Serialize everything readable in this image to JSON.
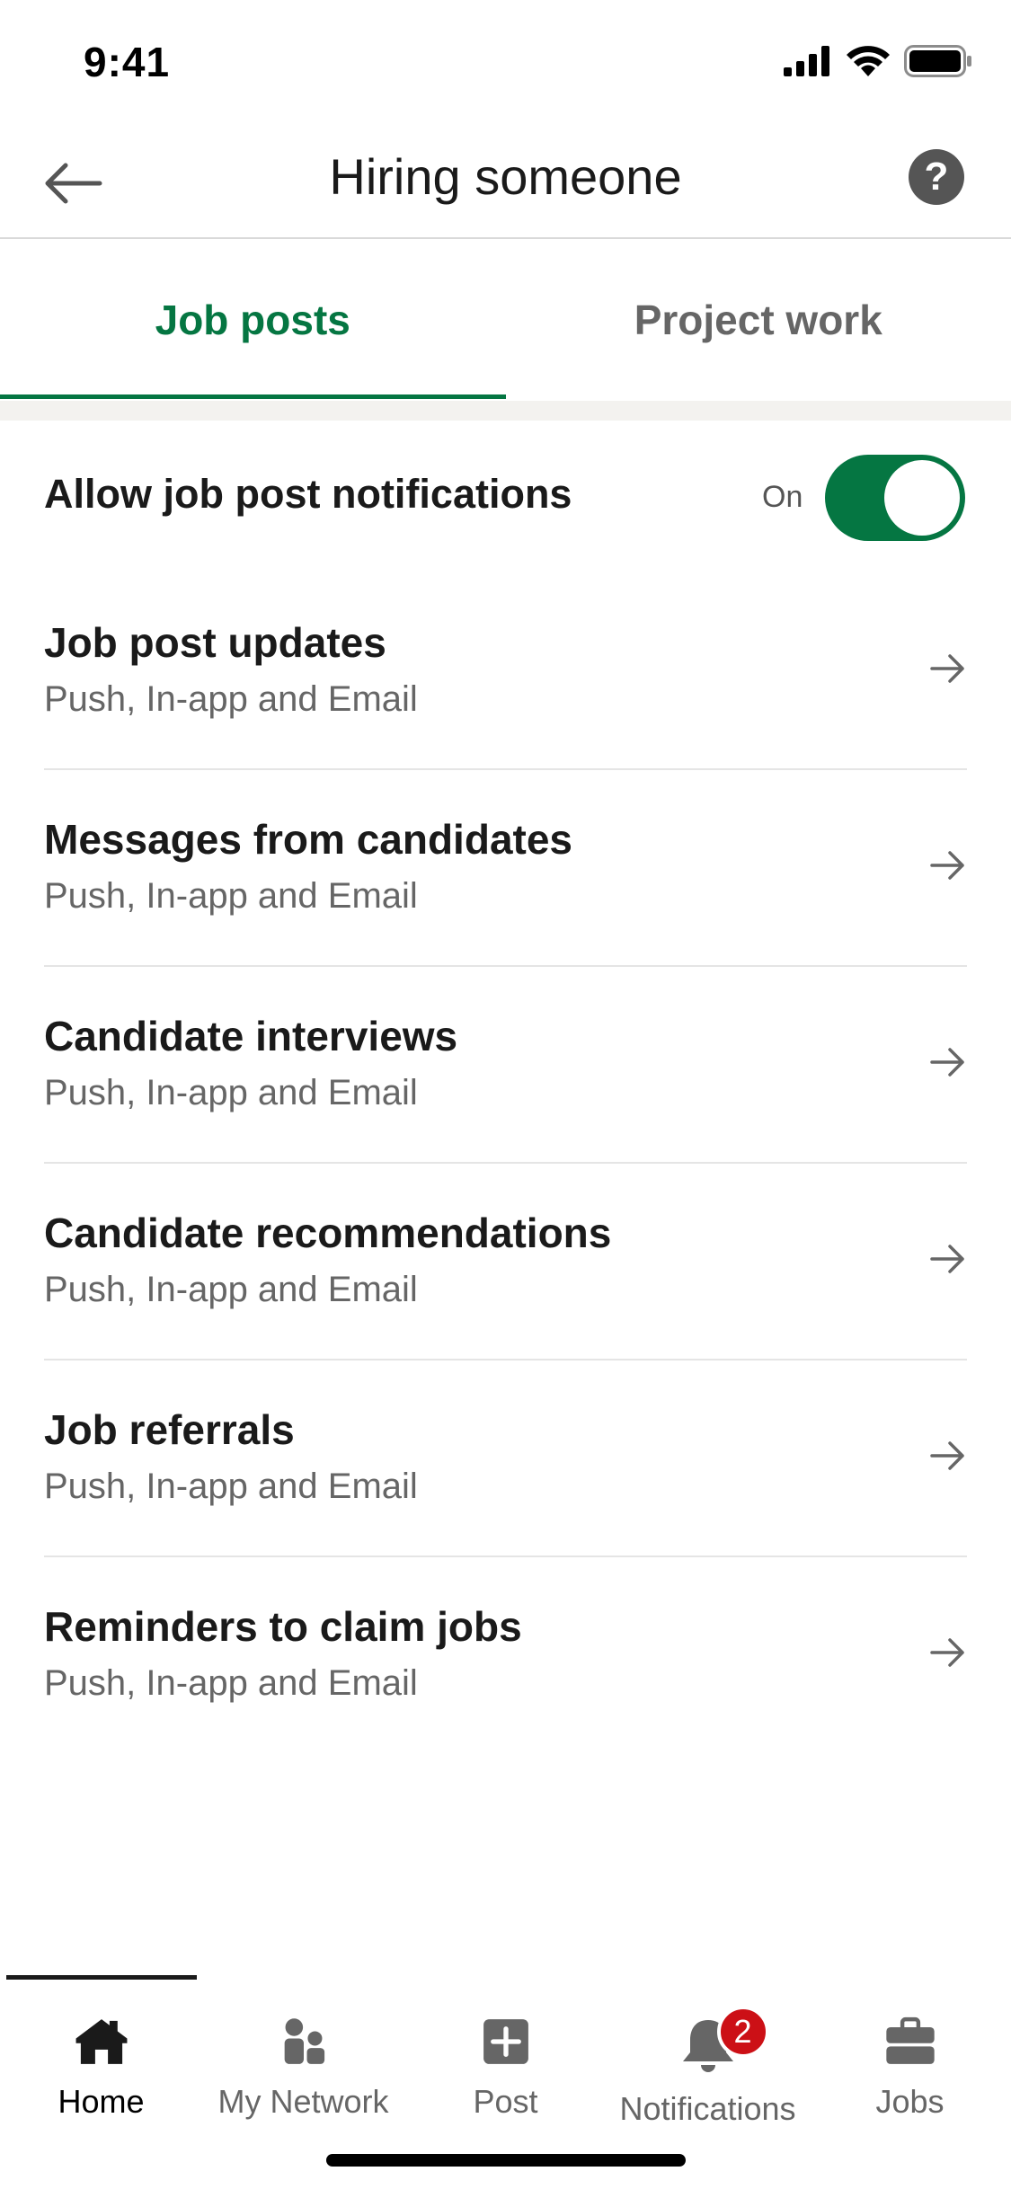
{
  "status_bar": {
    "time": "9:41",
    "icons": [
      "cellular-signal-icon",
      "wifi-icon",
      "battery-icon"
    ]
  },
  "header": {
    "title": "Hiring someone",
    "back_icon": "back-arrow-icon",
    "help_icon": "help-icon",
    "help_glyph": "?"
  },
  "tabs": [
    {
      "label": "Job posts",
      "active": true
    },
    {
      "label": "Project work",
      "active": false
    }
  ],
  "master_toggle": {
    "label": "Allow job post notifications",
    "state_label": "On",
    "enabled": true
  },
  "settings": [
    {
      "title": "Job post updates",
      "subtitle": "Push, In-app and Email"
    },
    {
      "title": "Messages from candidates",
      "subtitle": "Push, In-app and Email"
    },
    {
      "title": "Candidate interviews",
      "subtitle": "Push, In-app and Email"
    },
    {
      "title": "Candidate recommendations",
      "subtitle": "Push, In-app and Email"
    },
    {
      "title": "Job referrals",
      "subtitle": "Push, In-app and Email"
    },
    {
      "title": "Reminders to claim jobs",
      "subtitle": "Push, In-app and Email"
    }
  ],
  "bottom_nav": {
    "items": [
      {
        "label": "Home",
        "icon": "home-icon",
        "active": true
      },
      {
        "label": "My Network",
        "icon": "network-icon",
        "active": false
      },
      {
        "label": "Post",
        "icon": "post-icon",
        "active": false
      },
      {
        "label": "Notifications",
        "icon": "bell-icon",
        "active": false,
        "badge": "2"
      },
      {
        "label": "Jobs",
        "icon": "briefcase-icon",
        "active": false
      }
    ]
  },
  "colors": {
    "accent_green": "#057642",
    "badge_red": "#cc1016",
    "text_primary": "#1a1a1a",
    "text_secondary": "#666666"
  }
}
